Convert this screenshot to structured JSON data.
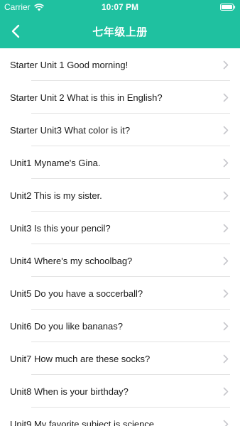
{
  "status_bar": {
    "carrier": "Carrier",
    "time": "10:07 PM",
    "wifi_icon": "wifi-icon",
    "battery_icon": "battery-icon"
  },
  "nav": {
    "title": "七年级上册",
    "back_icon": "chevron-left-icon"
  },
  "colors": {
    "accent": "#1fc1a0",
    "separator": "#e3e3e3",
    "chevron": "#c7c7cc"
  },
  "list": {
    "items": [
      {
        "label": "Starter Unit 1 Good morning!"
      },
      {
        "label": "Starter Unit 2 What is this in English?"
      },
      {
        "label": "Starter Unit3 What color is it?"
      },
      {
        "label": "Unit1 Myname's Gina."
      },
      {
        "label": "Unit2 This is my sister."
      },
      {
        "label": "Unit3 Is this your pencil?"
      },
      {
        "label": "Unit4 Where's my schoolbag?"
      },
      {
        "label": "Unit5 Do you have a soccerball?"
      },
      {
        "label": "Unit6 Do you like bananas?"
      },
      {
        "label": "Unit7 How much are these socks?"
      },
      {
        "label": "Unit8 When is your birthday?"
      },
      {
        "label": "Unit9 My favorite subject is science."
      }
    ]
  }
}
